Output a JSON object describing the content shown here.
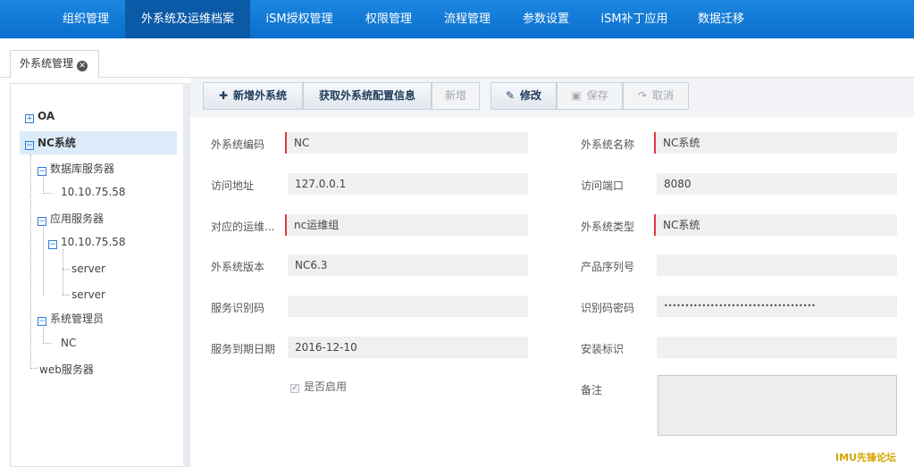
{
  "topnav": {
    "tabs": [
      {
        "label": "组织管理"
      },
      {
        "label": "外系统及运维档案",
        "active": true
      },
      {
        "label": "iSM授权管理"
      },
      {
        "label": "权限管理"
      },
      {
        "label": "流程管理"
      },
      {
        "label": "参数设置"
      },
      {
        "label": "iSM补丁应用"
      },
      {
        "label": "数据迁移"
      }
    ],
    "bar_color": "#1b86e0",
    "active_color": "#0b5aa8"
  },
  "page_tab": {
    "label": "外系统管理",
    "close_icon": "close-circle-icon"
  },
  "tree": {
    "nodes": [
      {
        "label": "OA"
      },
      {
        "label": "NC系统"
      },
      {
        "label": "数据库服务器"
      },
      {
        "label": "10.10.75.58"
      },
      {
        "label": "应用服务器"
      },
      {
        "label": "10.10.75.58"
      },
      {
        "label": "server"
      },
      {
        "label": "server"
      },
      {
        "label": "系统管理员"
      },
      {
        "label": "NC"
      },
      {
        "label": "web服务器"
      }
    ]
  },
  "toolbar": {
    "add_label": "新增外系统",
    "fetch_label": "获取外系统配置信息",
    "new_label": "新增",
    "edit_label": "修改",
    "save_label": "保存",
    "cancel_label": "取消"
  },
  "form": {
    "code_label": "外系统编码",
    "code_value": "NC",
    "name_label": "外系统名称",
    "name_value": "NC系统",
    "addr_label": "访问地址",
    "addr_value": "127.0.0.1",
    "port_label": "访问端口",
    "port_value": "8080",
    "ops_label": "对应的运维...",
    "ops_value": "nc运维组",
    "type_label": "外系统类型",
    "type_value": "NC系统",
    "version_label": "外系统版本",
    "version_value": "NC6.3",
    "serial_label": "产品序列号",
    "serial_value": "",
    "svcid_label": "服务识别码",
    "svcid_value": "",
    "idpwd_label": "识别码密码",
    "idpwd_value": "••••••••••••••••••••••••••••••••••••",
    "expire_label": "服务到期日期",
    "expire_value": "2016-12-10",
    "security_label": "安装标识",
    "security_value": "",
    "enabled_label": "是否启用",
    "enabled": true,
    "remark_label": "备注",
    "remark_value": ""
  },
  "accent_required": "#e0383b",
  "watermark": "IMU先锋论坛"
}
